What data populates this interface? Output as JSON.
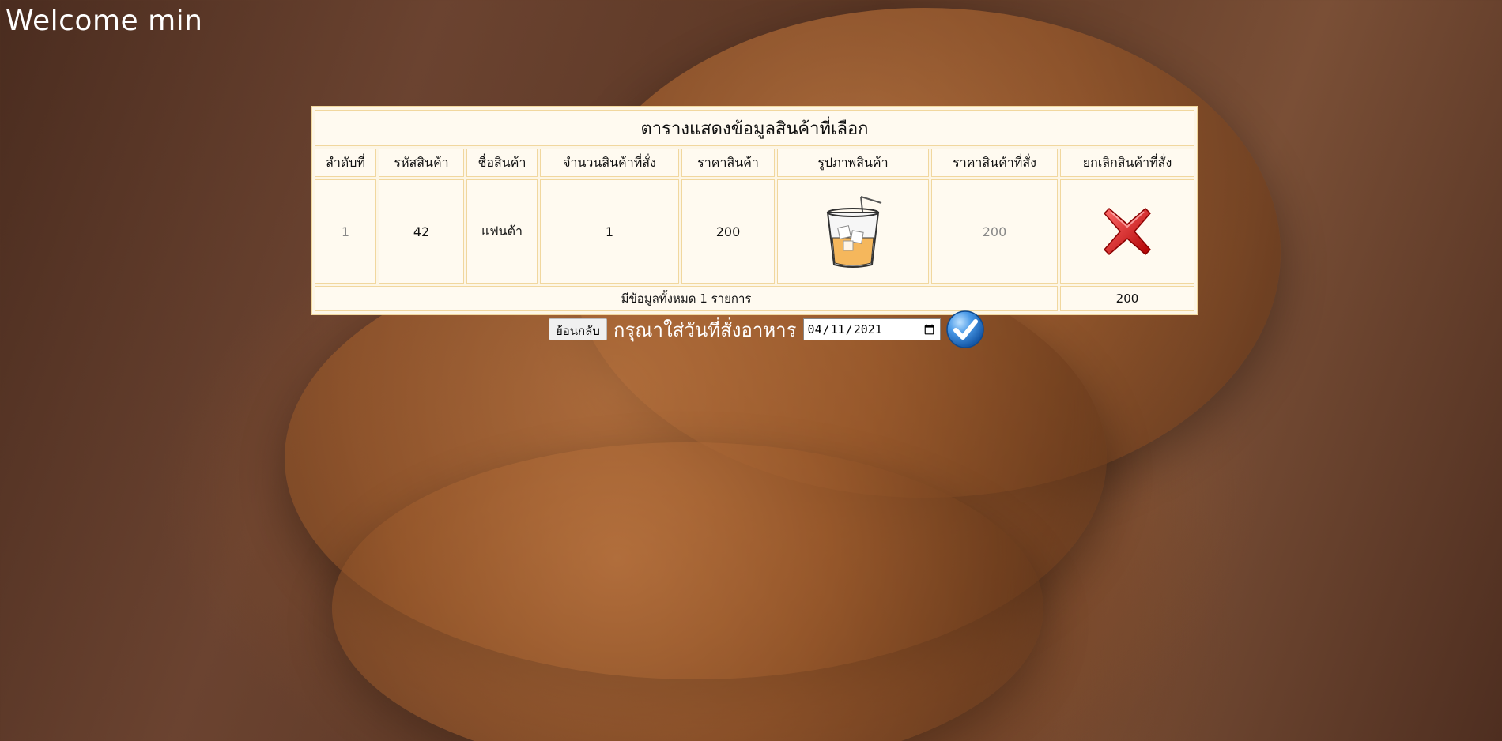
{
  "header": {
    "welcome": "Welcome min"
  },
  "table": {
    "caption": "ตารางแสดงข้อมูลสินค้าที่เลือก",
    "columns": [
      "ลำดับที่",
      "รหัสสินค้า",
      "ชื่อสินค้า",
      "จำนวนสินค้าที่สั่ง",
      "ราคาสินค้า",
      "รูปภาพสินค้า",
      "ราคาสินค้าที่สั่ง",
      "ยกเลิกสินค้าที่สั่ง"
    ],
    "rows": [
      {
        "index": "1",
        "product_code": "42",
        "product_name": "แฟนต้า",
        "quantity": "1",
        "price": "200",
        "image_icon": "iced-drink-icon",
        "ordered_price": "200",
        "cancel_icon": "red-x-icon"
      }
    ],
    "footer": {
      "summary": "มีข้อมูลทั้งหมด 1 รายการ",
      "total": "200"
    }
  },
  "controls": {
    "back_label": "ย้อนกลับ",
    "prompt": "กรุณาใส่วันที่สั่งอาหาร",
    "date_value": "2021-04-11",
    "confirm_icon": "blue-check-icon"
  },
  "colors": {
    "table_bg": "#fffaf0",
    "table_border": "#f1d79e",
    "cancel_red": "#e02020",
    "confirm_blue": "#2d7fd6"
  }
}
